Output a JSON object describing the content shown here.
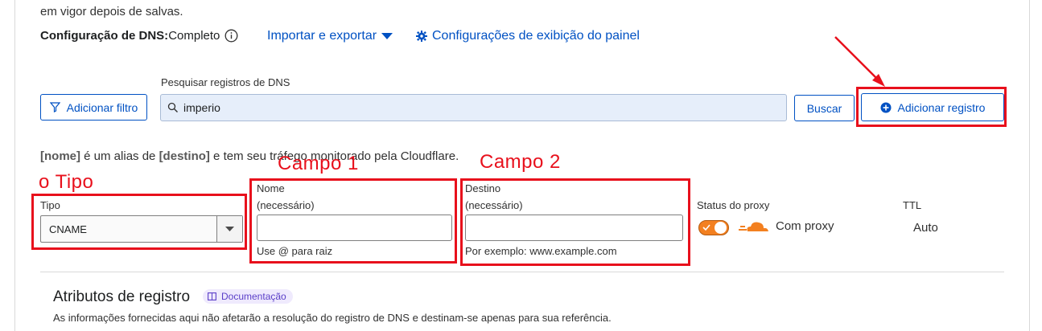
{
  "intro_text": "em vigor depois de salvas.",
  "dns_config": {
    "label": "Configuração de DNS:",
    "value": "Completo",
    "import_export": "Importar e exportar",
    "dashboard_settings": "Configurações de exibição do painel"
  },
  "search": {
    "label": "Pesquisar registros de DNS",
    "value": "imperio",
    "filter_button": "Adicionar filtro",
    "search_button": "Buscar",
    "add_record_button": "Adicionar registro"
  },
  "alias_note": {
    "nome": "[nome]",
    "middle": " é um alias de ",
    "destino": "[destino]",
    "end": " e tem seu tráfego monitorado pela Cloudflare."
  },
  "annotations": {
    "tipo": "o Tipo",
    "campo1": "Campo 1",
    "campo2": "Campo 2"
  },
  "form": {
    "type_label": "Tipo",
    "type_value": "CNAME",
    "name_label": "Nome",
    "name_required": "(necessário)",
    "name_hint": "Use @ para raiz",
    "target_label": "Destino",
    "target_required": "(necessário)",
    "target_hint": "Por exemplo: www.example.com",
    "proxy_label": "Status do proxy",
    "proxy_value": "Com proxy",
    "ttl_label": "TTL",
    "ttl_value": "Auto"
  },
  "attributes": {
    "title": "Atributos de registro",
    "doc_badge": "Documentação",
    "description": "As informações fornecidas aqui não afetarão a resolução do registro de DNS e destinam-se apenas para sua referência."
  },
  "colors": {
    "link": "#0051c3",
    "annotation": "#e8101c",
    "proxy_orange": "#f38020"
  }
}
